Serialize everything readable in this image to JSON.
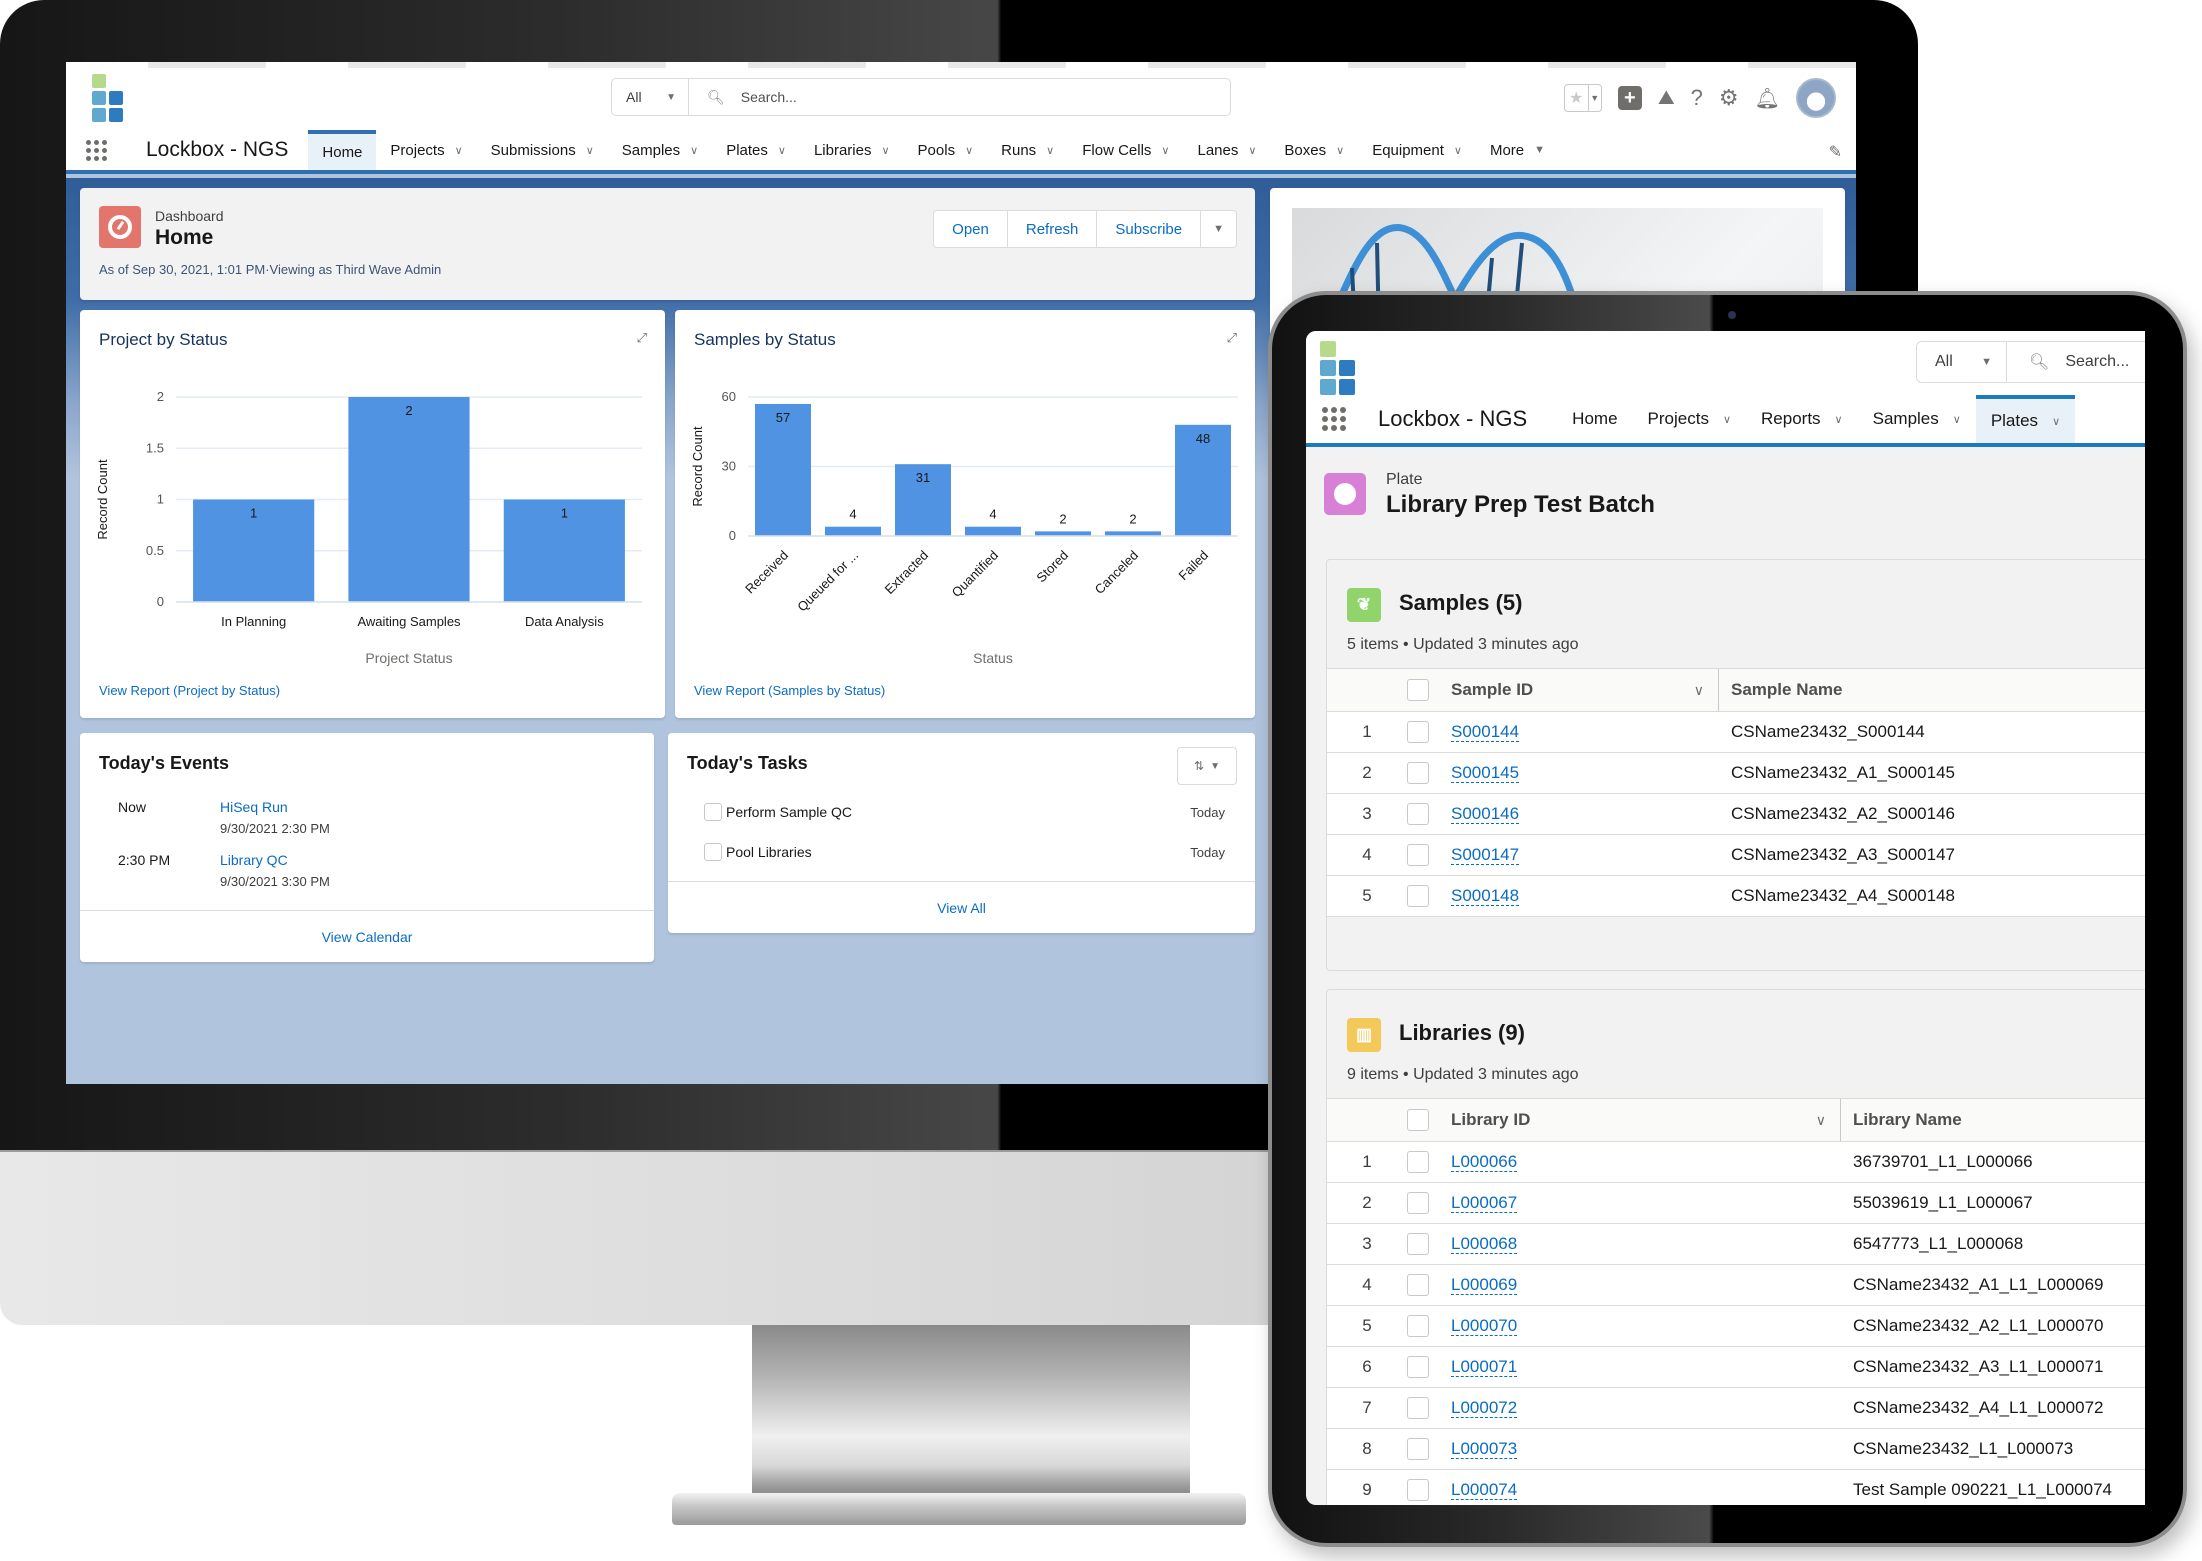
{
  "colors": {
    "brand_blue": "#2f70b3",
    "link_blue": "#0b6cc3",
    "bar_blue": "#5193e3",
    "dashboard_icon": "#e2766c",
    "plate_icon": "#d87fd6",
    "samples_icon": "#91d46b",
    "libraries_icon": "#f3c95a",
    "logo": [
      "#b7d98b",
      "#5fa8cf",
      "#2e7bbf",
      "#5fa8cf",
      "#2e7bbf"
    ]
  },
  "desktop": {
    "header": {
      "search_scope": "All",
      "search_placeholder": "Search...",
      "utility_icons": [
        "favorites-star-icon",
        "favorites-dropdown-icon",
        "global-actions-plus-icon",
        "trailhead-icon",
        "help-icon",
        "setup-gear-icon",
        "notifications-bell-icon",
        "user-avatar"
      ]
    },
    "nav": {
      "app_name": "Lockbox - NGS",
      "items": [
        {
          "label": "Home",
          "active": true,
          "has_menu": false
        },
        {
          "label": "Projects",
          "has_menu": true
        },
        {
          "label": "Submissions",
          "has_menu": true
        },
        {
          "label": "Samples",
          "has_menu": true
        },
        {
          "label": "Plates",
          "has_menu": true
        },
        {
          "label": "Libraries",
          "has_menu": true
        },
        {
          "label": "Pools",
          "has_menu": true
        },
        {
          "label": "Runs",
          "has_menu": true
        },
        {
          "label": "Flow Cells",
          "has_menu": true
        },
        {
          "label": "Lanes",
          "has_menu": true
        },
        {
          "label": "Boxes",
          "has_menu": true
        },
        {
          "label": "Equipment",
          "has_menu": true
        },
        {
          "label": "More",
          "has_menu": true
        }
      ],
      "chevron": "⌄",
      "more_caret": "▼"
    },
    "dashboard": {
      "type_label": "Dashboard",
      "title": "Home",
      "as_of": "As of Sep 30, 2021, 1:01 PM·Viewing as Third Wave Admin",
      "buttons": [
        "Open",
        "Refresh",
        "Subscribe"
      ],
      "more_caret": "▼"
    },
    "events": {
      "title": "Today's Events",
      "items": [
        {
          "time": "Now",
          "name": "HiSeq Run",
          "datetime": "9/30/2021 2:30 PM"
        },
        {
          "time": "2:30 PM",
          "name": "Library QC",
          "datetime": "9/30/2021 3:30 PM"
        }
      ],
      "footer": "View Calendar"
    },
    "tasks": {
      "title": "Today's Tasks",
      "items": [
        {
          "label": "Perform Sample QC",
          "due": "Today"
        },
        {
          "label": "Pool Libraries",
          "due": "Today"
        }
      ],
      "footer": "View All"
    }
  },
  "chart_data": [
    {
      "type": "bar",
      "title": "Project by Status",
      "categories": [
        "In Planning",
        "Awaiting Samples",
        "Data Analysis"
      ],
      "values": [
        1,
        2,
        1
      ],
      "xlabel": "Project Status",
      "ylabel": "Record Count",
      "ylim": [
        0,
        2
      ],
      "yticks": [
        0,
        0.5,
        1,
        1.5,
        2
      ],
      "ytick_labels": [
        "0",
        "0.5",
        "1",
        "1.5",
        "2"
      ],
      "grid": true,
      "data_labels": true,
      "link": "View Report (Project by Status)"
    },
    {
      "type": "bar",
      "title": "Samples by Status",
      "categories": [
        "Received",
        "Queued for ...",
        "Extracted",
        "Quantified",
        "Stored",
        "Canceled",
        "Failed"
      ],
      "values": [
        57,
        4,
        31,
        4,
        2,
        2,
        48
      ],
      "xlabel": "Status",
      "ylabel": "Record Count",
      "ylim": [
        0,
        60
      ],
      "yticks": [
        0,
        30,
        60
      ],
      "ytick_labels": [
        "0",
        "30",
        "60"
      ],
      "grid": true,
      "data_labels": true,
      "rotated_x_labels": true,
      "link": "View Report (Samples by Status)"
    }
  ],
  "tablet": {
    "header": {
      "search_scope": "All",
      "search_placeholder": "Search..."
    },
    "nav": {
      "app_name": "Lockbox - NGS",
      "items": [
        {
          "label": "Home",
          "has_menu": false
        },
        {
          "label": "Projects",
          "has_menu": true
        },
        {
          "label": "Reports",
          "has_menu": true
        },
        {
          "label": "Samples",
          "has_menu": true
        },
        {
          "label": "Plates",
          "has_menu": true,
          "active": true
        }
      ]
    },
    "record": {
      "type_label": "Plate",
      "title": "Library Prep Test Batch"
    },
    "samples": {
      "title": "Samples (5)",
      "subtitle": "5 items • Updated 3 minutes ago",
      "columns": [
        "Sample ID",
        "Sample Name"
      ],
      "rows": [
        {
          "num": "1",
          "id": "S000144",
          "name": "CSName23432_S000144"
        },
        {
          "num": "2",
          "id": "S000145",
          "name": "CSName23432_A1_S000145"
        },
        {
          "num": "3",
          "id": "S000146",
          "name": "CSName23432_A2_S000146"
        },
        {
          "num": "4",
          "id": "S000147",
          "name": "CSName23432_A3_S000147"
        },
        {
          "num": "5",
          "id": "S000148",
          "name": "CSName23432_A4_S000148"
        }
      ]
    },
    "libraries": {
      "title": "Libraries (9)",
      "subtitle": "9 items • Updated 3 minutes ago",
      "columns": [
        "Library ID",
        "Library Name"
      ],
      "rows": [
        {
          "num": "1",
          "id": "L000066",
          "name": "36739701_L1_L000066"
        },
        {
          "num": "2",
          "id": "L000067",
          "name": "55039619_L1_L000067"
        },
        {
          "num": "3",
          "id": "L000068",
          "name": "6547773_L1_L000068"
        },
        {
          "num": "4",
          "id": "L000069",
          "name": "CSName23432_A1_L1_L000069"
        },
        {
          "num": "5",
          "id": "L000070",
          "name": "CSName23432_A2_L1_L000070"
        },
        {
          "num": "6",
          "id": "L000071",
          "name": "CSName23432_A3_L1_L000071"
        },
        {
          "num": "7",
          "id": "L000072",
          "name": "CSName23432_A4_L1_L000072"
        },
        {
          "num": "8",
          "id": "L000073",
          "name": "CSName23432_L1_L000073"
        },
        {
          "num": "9",
          "id": "L000074",
          "name": "Test Sample 090221_L1_L000074"
        }
      ]
    }
  }
}
